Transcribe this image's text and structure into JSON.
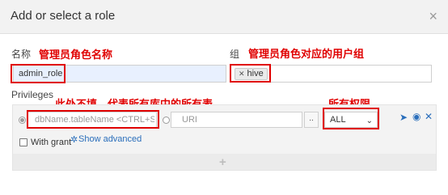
{
  "dialog": {
    "title": "Add or select a role",
    "close_icon": "×"
  },
  "form": {
    "name_label": "名称",
    "name_value": "admin_role",
    "group_label": "组",
    "group_tag": "hive",
    "privileges_label": "Privileges"
  },
  "privilege": {
    "path_placeholder": "dbName.tableName <CTRL+SPACE",
    "uri_placeholder": "URI",
    "browse_label": "..",
    "action_value": "ALL",
    "with_grant_label": "With grant",
    "show_advanced_label": "Show advanced",
    "add_label": "+"
  },
  "annotations": {
    "name": "管理员角色名称",
    "group": "管理员角色对应的用户组",
    "path": "此处不填，代表所有库中的所有表",
    "action": "所有权限"
  },
  "colors": {
    "annotation": "#e00000",
    "icon_blue": "#2a6ebb"
  }
}
